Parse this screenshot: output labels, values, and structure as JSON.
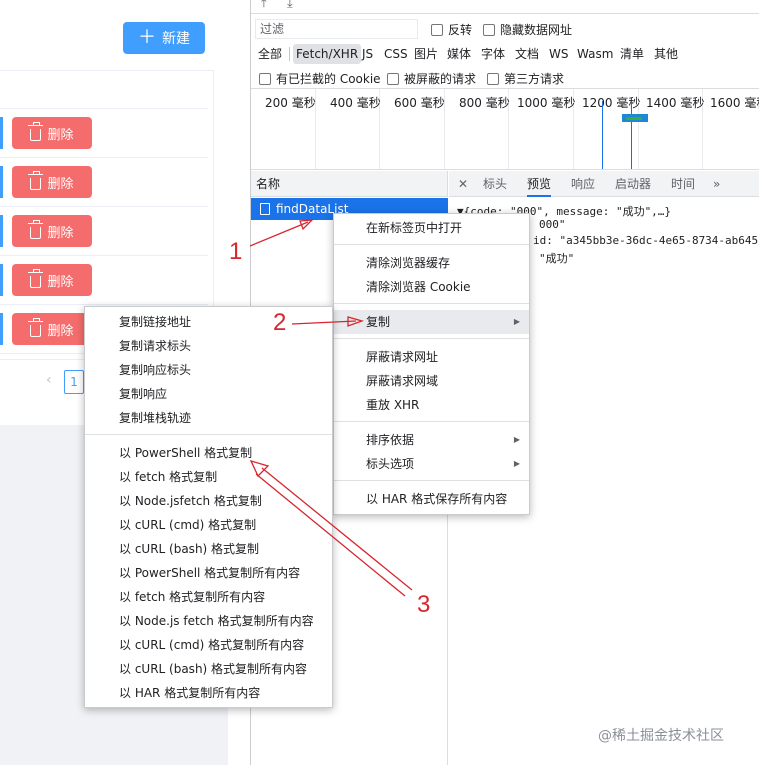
{
  "app": {
    "new_button": "新建",
    "delete_label": "删除",
    "pager_page": "1"
  },
  "devtools": {
    "filter_placeholder": "过滤",
    "invert": "反转",
    "hide_data_urls": "隐藏数据网址",
    "type_filters": [
      "全部",
      "Fetch/XHR",
      "JS",
      "CSS",
      "图片",
      "媒体",
      "字体",
      "文档",
      "WS",
      "Wasm",
      "清单",
      "其他"
    ],
    "active_type": "Fetch/XHR",
    "blocked_cookies": "有已拦截的 Cookie",
    "blocked_requests": "被屏蔽的请求",
    "third_party": "第三方请求",
    "timeline_labels": [
      "200 毫秒",
      "400 毫秒",
      "600 毫秒",
      "800 毫秒",
      "1000 毫秒",
      "1200 毫秒",
      "1400 毫秒",
      "1600 毫秒"
    ],
    "list_header": "名称",
    "request_name": "findDataList",
    "tabs": [
      "标头",
      "预览",
      "响应",
      "启动器",
      "时间"
    ],
    "active_tab": "预览",
    "preview_lines": [
      "▼{code: \"000\", message: \"成功\",…}",
      "000\"",
      "id: \"a345bb3e-36dc-4e65-8734-ab645b",
      "\"成功\""
    ]
  },
  "context_menu": {
    "items": [
      "在新标签页中打开",
      "清除浏览器缓存",
      "清除浏览器 Cookie",
      "复制",
      "屏蔽请求网址",
      "屏蔽请求网域",
      "重放 XHR",
      "排序依据",
      "标头选项",
      "以 HAR 格式保存所有内容"
    ],
    "highlighted": "复制"
  },
  "copy_submenu": {
    "items": [
      "复制链接地址",
      "复制请求标头",
      "复制响应标头",
      "复制响应",
      "复制堆栈轨迹",
      "以 PowerShell 格式复制",
      "以 fetch 格式复制",
      "以 Node.jsfetch 格式复制",
      "以 cURL (cmd) 格式复制",
      "以 cURL (bash) 格式复制",
      "以 PowerShell 格式复制所有内容",
      "以 fetch 格式复制所有内容",
      "以 Node.js fetch 格式复制所有内容",
      "以 cURL (cmd) 格式复制所有内容",
      "以 cURL (bash) 格式复制所有内容",
      "以 HAR 格式复制所有内容"
    ]
  },
  "annotations": {
    "step1": "1",
    "step2": "2",
    "step3": "3",
    "color": "#d7262e"
  },
  "watermark": "@稀土掘金技术社区"
}
